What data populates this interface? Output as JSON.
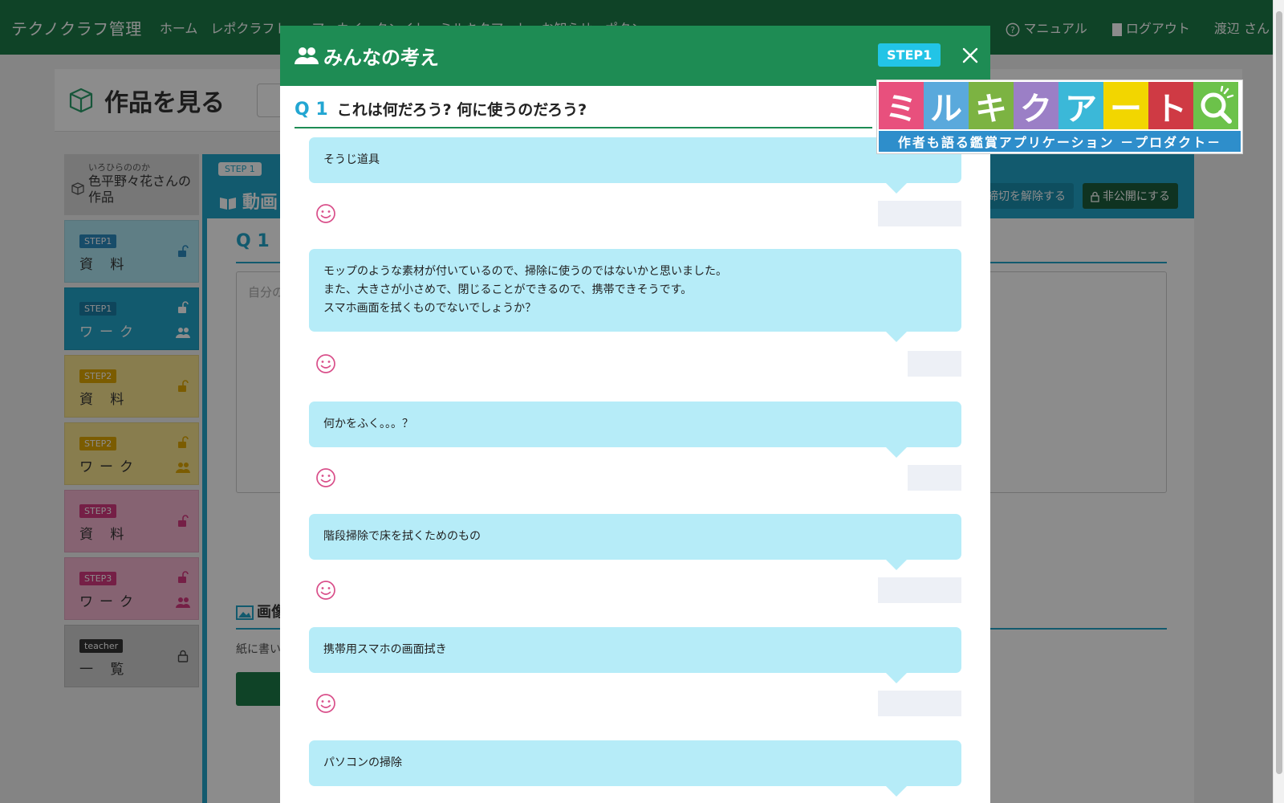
{
  "navbar": {
    "brand": "テクノクラフ管理",
    "items": [
      "ホーム",
      "レポクラフト",
      "アーカイ",
      "タンイト",
      "ミルキクアート",
      "お知らせ",
      "ポタン"
    ],
    "manual": "マニュアル",
    "logout": "ログアウト",
    "user": "渡辺 さん"
  },
  "page": {
    "title": "作品を見る"
  },
  "sidebar": {
    "owner_ruby": "いろひらののか",
    "owner_name": "色平野々花さんの作品",
    "cards": [
      {
        "badge": "STEP1",
        "label": "資 料"
      },
      {
        "badge": "STEP1",
        "label": "ワーク"
      },
      {
        "badge": "STEP2",
        "label": "資 料"
      },
      {
        "badge": "STEP2",
        "label": "ワーク"
      },
      {
        "badge": "STEP3",
        "label": "資 料"
      },
      {
        "badge": "STEP3",
        "label": "ワーク"
      },
      {
        "badge": "teacher",
        "label": "一 覧"
      }
    ]
  },
  "content": {
    "step_tag": "STEP 1",
    "section_title": "動画",
    "unlock_button": "締切を解除する",
    "private_button": "非公開にする",
    "question_number": "Q 1",
    "textarea_placeholder": "自分の",
    "image_section": "画像",
    "image_note": "紙に書い"
  },
  "modal": {
    "title": "みんなの考え",
    "step_badge": "STEP1",
    "question_number": "Q 1",
    "question_text": "これは何だろう? 何に使うのだろう?",
    "answers": [
      {
        "text": "そうじ道具"
      },
      {
        "text": "モップのような素材が付いているので、掃除に使うのではないかと思いました。\nまた、大きさが小さめで、閉じることができるので、携帯できそうです。\nスマホ画面を拭くものでないでしょうか？"
      },
      {
        "text": "何かをふく。。。？"
      },
      {
        "text": "階段掃除で床を拭くためのもの"
      },
      {
        "text": "携帯用スマホの画面拭き"
      },
      {
        "text": "パソコンの掃除"
      }
    ]
  },
  "logo": {
    "tiles": [
      "ミ",
      "ル",
      "キ",
      "ク",
      "ア",
      "ー",
      "ト"
    ],
    "tile_colors": [
      "#e8507d",
      "#5aa9dc",
      "#7cb342",
      "#9b7fc6",
      "#3bb8d8",
      "#f2d600",
      "#cf3a44",
      "#6cc24a"
    ],
    "tagline": "作者も語る鑑賞アプリケーション －プロダクト－"
  }
}
